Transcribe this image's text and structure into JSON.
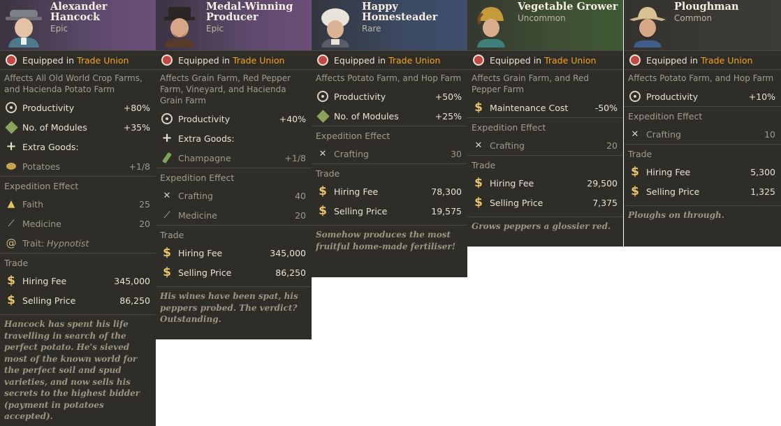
{
  "equipped_prefix": "Equipped in",
  "equipped_location": "Trade Union",
  "expedition_header": "Expedition Effect",
  "trade_header": "Trade",
  "hiring_label": "Hiring Fee",
  "selling_label": "Selling Price",
  "colors": {
    "card_bg": "#2e2d27",
    "highlight": "#f4a51c",
    "epic": "#6b4f78",
    "rare": "#3d4e6b",
    "uncommon": "#3f5a34",
    "common": "#3d3b36"
  },
  "cards": [
    {
      "name": "Alexander Hancock",
      "rarity": "Epic",
      "affects": "Affects All Old World Crop Farms, and Hacienda Potato Farm",
      "stats": [
        {
          "label": "Productivity",
          "value": "+80%",
          "icon": "productivity-icon"
        },
        {
          "label": "No. of Modules",
          "value": "+35%",
          "icon": "modules-icon"
        },
        {
          "label": "Extra Goods:",
          "value": "",
          "icon": "plus-icon"
        },
        {
          "label": "Potatoes",
          "value": "+1/8",
          "icon": "potato-icon"
        }
      ],
      "expedition": [
        {
          "label": "Faith",
          "value": "25",
          "icon": "faith-icon"
        },
        {
          "label": "Medicine",
          "value": "20",
          "icon": "medicine-icon"
        },
        {
          "label_prefix": "Trait: ",
          "label_trait": "Hypnotist",
          "icon": "hypnotist-icon"
        }
      ],
      "hiring_fee": "345,000",
      "selling_price": "86,250",
      "flavor": "Hancock has spent his life travelling in search of the perfect potato. He's sieved most of the known world for the perfect soil and spud varieties, and now sells his secrets to the highest bidder (payment in potatoes accepted)."
    },
    {
      "name": "Medal-Winning Producer",
      "rarity": "Epic",
      "affects": "Affects Grain Farm, Red Pepper Farm, Vineyard, and Hacienda Grain Farm",
      "stats": [
        {
          "label": "Productivity",
          "value": "+40%",
          "icon": "productivity-icon"
        },
        {
          "label": "Extra Goods:",
          "value": "",
          "icon": "plus-icon"
        },
        {
          "label": "Champagne",
          "value": "+1/8",
          "icon": "champagne-icon"
        }
      ],
      "expedition": [
        {
          "label": "Crafting",
          "value": "40",
          "icon": "crafting-icon"
        },
        {
          "label": "Medicine",
          "value": "20",
          "icon": "medicine-icon"
        }
      ],
      "hiring_fee": "345,000",
      "selling_price": "86,250",
      "flavor": "His wines have been spat, his peppers probed. The verdict? Outstanding."
    },
    {
      "name": "Happy Homesteader",
      "rarity": "Rare",
      "affects": "Affects Potato Farm, and Hop Farm",
      "stats": [
        {
          "label": "Productivity",
          "value": "+50%",
          "icon": "productivity-icon"
        },
        {
          "label": "No. of Modules",
          "value": "+25%",
          "icon": "modules-icon"
        }
      ],
      "expedition": [
        {
          "label": "Crafting",
          "value": "30",
          "icon": "crafting-icon"
        }
      ],
      "hiring_fee": "78,300",
      "selling_price": "19,575",
      "flavor": "Somehow produces the most fruitful home-made fertiliser!"
    },
    {
      "name": "Vegetable Grower",
      "rarity": "Uncommon",
      "affects": "Affects Grain Farm, and Red Pepper Farm",
      "stats": [
        {
          "label": "Maintenance Cost",
          "value": "-50%",
          "icon": "maintenance-icon"
        }
      ],
      "expedition": [
        {
          "label": "Crafting",
          "value": "20",
          "icon": "crafting-icon"
        }
      ],
      "hiring_fee": "29,500",
      "selling_price": "7,375",
      "flavor": "Grows peppers a glossier red."
    },
    {
      "name": "Ploughman",
      "rarity": "Common",
      "affects": "Affects Potato Farm, and Hop Farm",
      "stats": [
        {
          "label": "Productivity",
          "value": "+10%",
          "icon": "productivity-icon"
        }
      ],
      "expedition": [
        {
          "label": "Crafting",
          "value": "10",
          "icon": "crafting-icon"
        }
      ],
      "hiring_fee": "5,300",
      "selling_price": "1,325",
      "flavor": "Ploughs on through."
    }
  ]
}
